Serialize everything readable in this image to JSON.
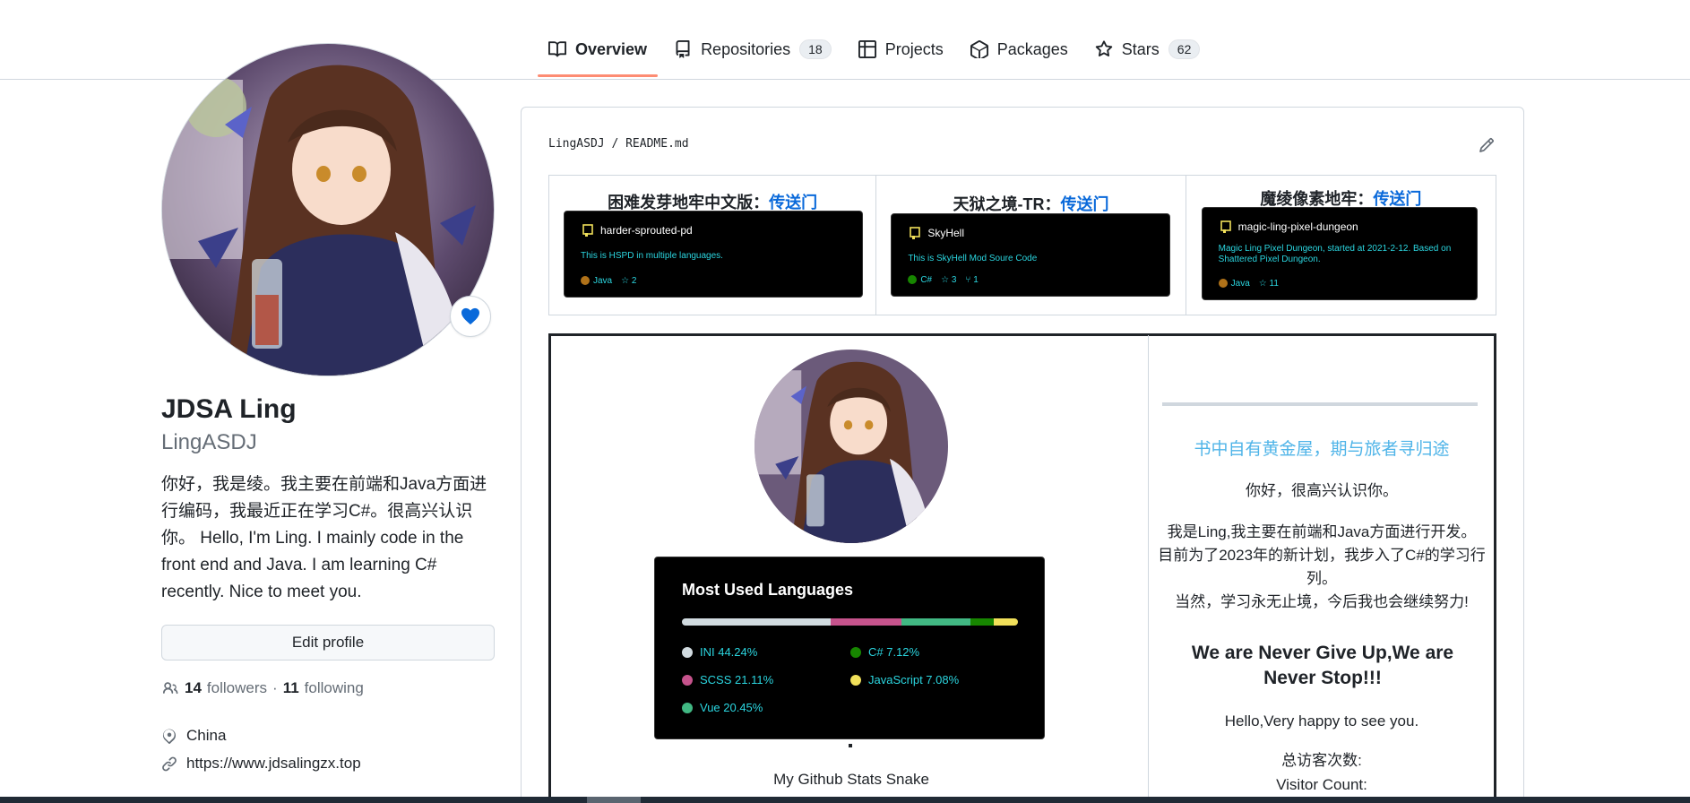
{
  "tabs": [
    {
      "label": "Overview",
      "count": "",
      "icon": "book-icon",
      "active": true
    },
    {
      "label": "Repositories",
      "count": "18",
      "icon": "repo-icon"
    },
    {
      "label": "Projects",
      "count": "",
      "icon": "table-icon"
    },
    {
      "label": "Packages",
      "count": "",
      "icon": "package-icon"
    },
    {
      "label": "Stars",
      "count": "62",
      "icon": "star-icon"
    }
  ],
  "profile": {
    "name": "JDSA Ling",
    "login": "LingASDJ",
    "bio": "你好，我是绫。我主要在前端和Java方面进行编码，我最近正在学习C#。很高兴认识你。 Hello, I'm Ling. I mainly code in the front end and Java. I am learning C# recently. Nice to meet you.",
    "edit_label": "Edit profile",
    "followers_count": "14",
    "followers_label": "followers",
    "separator": "·",
    "following_count": "11",
    "following_label": "following",
    "location": "China",
    "website": "https://www.jdsalingzx.top"
  },
  "readme": {
    "path_owner": "LingASDJ",
    "path_sep": "/",
    "path_file": "README.md",
    "projects": [
      {
        "title": "困难发芽地牢中文版：",
        "link": "传送门",
        "repo": "harder-sprouted-pd",
        "desc": "This is HSPD in multiple languages.",
        "lang": "Java",
        "lang_color": "#b07219",
        "stars": "2"
      },
      {
        "title": "天狱之境-TR：",
        "link": "传送门",
        "repo": "SkyHell",
        "desc": "This is SkyHell Mod Soure Code",
        "lang": "C#",
        "lang_color": "#178600",
        "stars": "3",
        "forks": "1"
      },
      {
        "title": "魔绫像素地牢：",
        "link": "传送门",
        "repo": "magic-ling-pixel-dungeon",
        "desc": "Magic Ling Pixel Dungeon, started at 2021-2-12. Based on Shattered Pixel Dungeon.",
        "lang": "Java",
        "lang_color": "#b07219",
        "stars": "11"
      }
    ],
    "languages": {
      "title": "Most Used Languages",
      "items": [
        {
          "name": "INI",
          "percent": 44.24,
          "label": "INI 44.24%",
          "color": "#d1dbe0"
        },
        {
          "name": "SCSS",
          "percent": 21.11,
          "label": "SCSS 21.11%",
          "color": "#c6538c"
        },
        {
          "name": "Vue",
          "percent": 20.45,
          "label": "Vue 20.45%",
          "color": "#41b883"
        },
        {
          "name": "C#",
          "percent": 7.12,
          "label": "C# 7.12%",
          "color": "#178600"
        },
        {
          "name": "JavaScript",
          "percent": 7.08,
          "label": "JavaScript 7.08%",
          "color": "#f1e05a"
        }
      ]
    },
    "snake_caption": "My Github Stats Snake",
    "motto": "书中自有黄金屋，期与旅者寻归途",
    "greet_cn": "你好，很高兴认识你。",
    "intro_cn_1": "我是Ling,我主要在前端和Java方面进行开发。",
    "intro_cn_2": "目前为了2023年的新计划，我步入了C#的学习行列。",
    "intro_cn_3": "当然，学习永无止境，今后我也会继续努力!",
    "slogan": "We are Never Give Up,We are Never Stop!!!",
    "hello_en": "Hello,Very happy to see you.",
    "visitor_cn": "总访客次数:",
    "visitor_en": "Visitor Count:"
  },
  "colors": {
    "accent_underline": "#fd8c73",
    "link": "#0969da",
    "muted": "#656d76",
    "card_text": "#2bd6e0",
    "motto": "#4fb4e8",
    "status_heart": "#0969da"
  }
}
